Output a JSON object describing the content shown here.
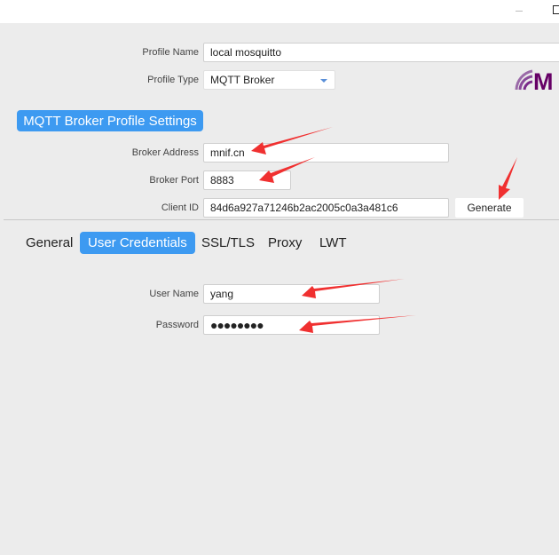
{
  "window": {
    "minimize_icon": "minimize-icon",
    "maximize_icon": "maximize-icon"
  },
  "profile": {
    "name_label": "Profile Name",
    "name_value": "local mosquitto",
    "type_label": "Profile Type",
    "type_value": "MQTT Broker"
  },
  "logo": {
    "text": "MQTT",
    "color": "#660066"
  },
  "section": {
    "title": "MQTT Broker Profile Settings",
    "accent": "#3d9af1"
  },
  "broker": {
    "address_label": "Broker Address",
    "address_value": "mnif.cn",
    "port_label": "Broker Port",
    "port_value": "8883",
    "client_id_label": "Client ID",
    "client_id_value": "84d6a927a71246b2ac2005c0a3a481c6",
    "generate_label": "Generate"
  },
  "tabs": [
    {
      "label": "General"
    },
    {
      "label": "User Credentials",
      "active": true
    },
    {
      "label": "SSL/TLS"
    },
    {
      "label": "Proxy"
    },
    {
      "label": "LWT"
    }
  ],
  "credentials": {
    "username_label": "User Name",
    "username_value": "yang",
    "password_label": "Password",
    "password_value": "●●●●●●●●"
  },
  "annotation": {
    "arrow_color": "#f03030"
  }
}
